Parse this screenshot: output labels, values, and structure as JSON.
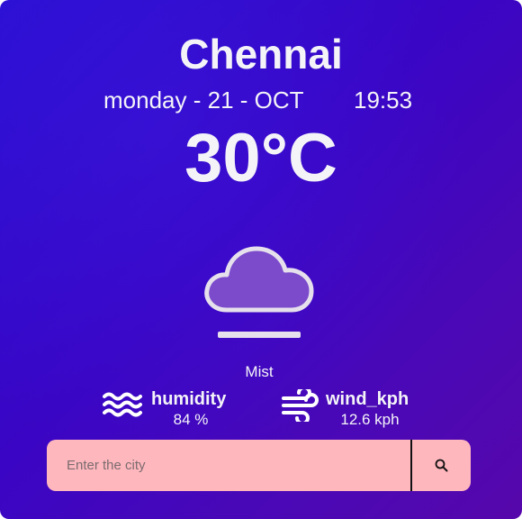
{
  "weather": {
    "city": "Chennai",
    "date": "monday - 21 - OCT",
    "time": "19:53",
    "temperature": "30°C",
    "condition": "Mist",
    "condition_icon": "cloud-mist-icon"
  },
  "stats": {
    "humidity": {
      "label": "humidity",
      "value": "84 %",
      "icon": "water-waves-icon"
    },
    "wind": {
      "label": "wind_kph",
      "value": "12.6 kph",
      "icon": "wind-icon"
    }
  },
  "search": {
    "placeholder": "Enter the city",
    "button_icon": "search-icon"
  },
  "colors": {
    "background_start": "#2a0fd2",
    "background_end": "#5607ab",
    "text": "#f4f4f8",
    "search_bar": "#ffb7be",
    "cloud_fill": "#7b4bcc",
    "cloud_outline": "#e6e0ec"
  }
}
